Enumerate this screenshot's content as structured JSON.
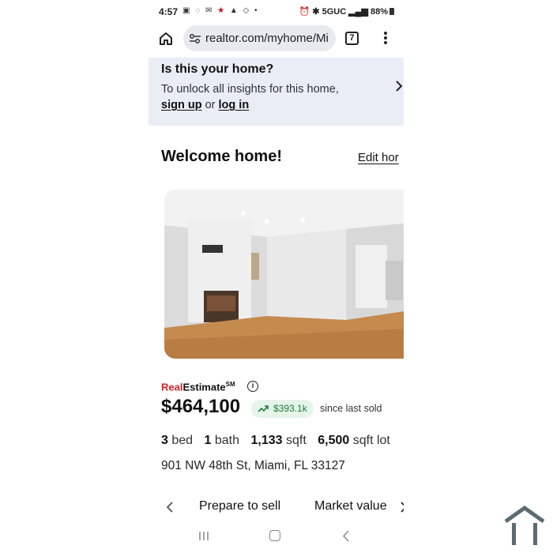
{
  "status_bar": {
    "time": "4:57",
    "network": "5GUC",
    "battery": "88%"
  },
  "browser": {
    "url": "realtor.com/myhome/Mi",
    "tab_count": "7"
  },
  "banner": {
    "title": "Is this your home?",
    "text": "To unlock all insights for this home,",
    "sign_up": "sign up",
    "or": "or",
    "log_in": "log in"
  },
  "welcome": {
    "title": "Welcome home!",
    "edit_link": "Edit hor"
  },
  "estimate": {
    "brand_real": "Real",
    "brand_estimate": "Estimate",
    "brand_sup": "SM",
    "info_icon": "i",
    "price": "$464,100",
    "change": "$393.1k",
    "since": "since last sold",
    "accent_green": "#1e7d32",
    "accent_red": "#d92228"
  },
  "facts": {
    "beds_value": "3",
    "beds_label": "bed",
    "baths_value": "1",
    "baths_label": "bath",
    "sqft_value": "1,133",
    "sqft_label": "sqft",
    "lot_value": "6,500",
    "lot_label": "sqft lot"
  },
  "address": "901 NW 48th St, Miami, FL 33127",
  "tabs": {
    "prepare": "Prepare to sell",
    "market": "Market value"
  },
  "icons": [
    "home-icon",
    "tune-icon",
    "kebab-icon",
    "chevron-right-icon",
    "info-icon",
    "trend-up-icon",
    "chevron-left-icon",
    "recents-icon",
    "nav-home-icon",
    "back-icon",
    "watermark-icon"
  ]
}
